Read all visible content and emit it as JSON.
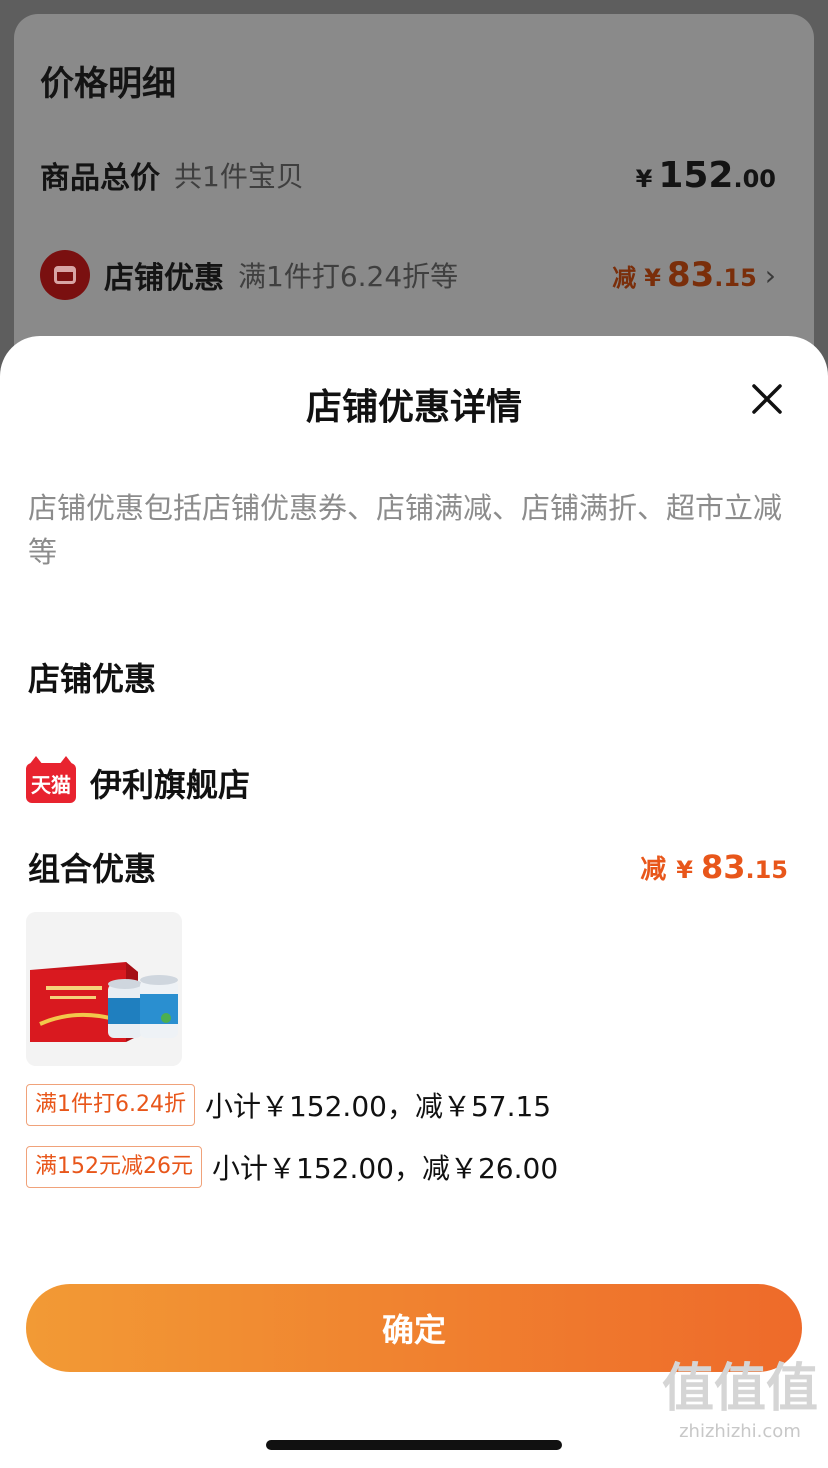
{
  "background": {
    "title": "价格明细",
    "total_row": {
      "label": "商品总价",
      "sub": "共1件宝贝",
      "currency": "¥",
      "amount_int": "152",
      "amount_dec": ".00"
    },
    "shop_row": {
      "label": "店铺优惠",
      "sub": "满1件打6.24折等",
      "prefix": "减",
      "currency": "¥",
      "amount_int": "83",
      "amount_dec": ".15",
      "icon": "chevron-right-icon"
    }
  },
  "sheet": {
    "title": "店铺优惠详情",
    "close_icon": "close-icon",
    "description": "店铺优惠包括店铺优惠券、店铺满减、店铺满折、超市立减等",
    "section_title": "店铺优惠",
    "store": {
      "logo_text": "天猫",
      "name": "伊利旗舰店"
    },
    "combo": {
      "title": "组合优惠",
      "prefix": "减",
      "currency": "¥",
      "amount_int": "83",
      "amount_dec": ".15"
    },
    "promotions": [
      {
        "tag": "满1件打6.24折",
        "text": "小计￥152.00，减￥57.15"
      },
      {
        "tag": "满152元减26元",
        "text": "小计￥152.00，减￥26.00"
      }
    ],
    "confirm_label": "确定"
  },
  "watermark": {
    "big": "值值值",
    "small": "zhizhizhi.com"
  },
  "colors": {
    "accent": "#e8561a",
    "button_start": "#f29a35",
    "button_end": "#ee6a2a",
    "tmall_red": "#e8232f"
  }
}
